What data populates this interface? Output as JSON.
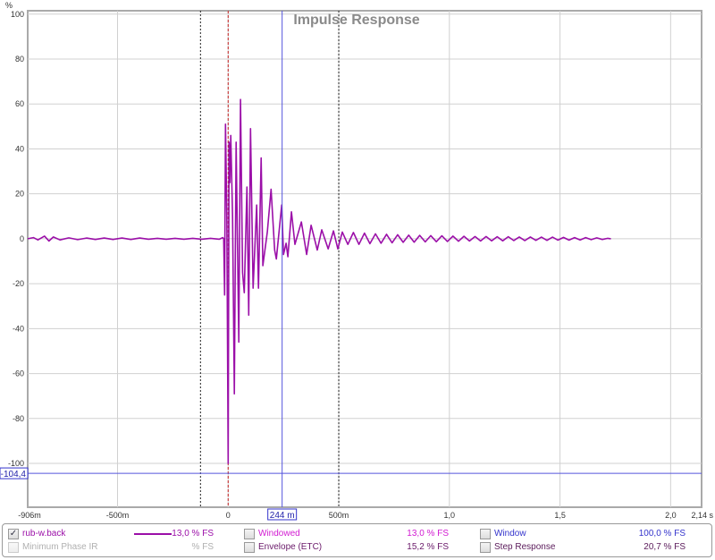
{
  "chart_data": {
    "type": "line",
    "title": "Impulse Response",
    "ylabel": "%",
    "xlabel_unit": "s",
    "xlim": [
      -0.906,
      2.14
    ],
    "ylim": [
      -119.5,
      101.5
    ],
    "grid": true,
    "y_ticks": [
      100,
      80,
      60,
      40,
      20,
      0,
      -20,
      -40,
      -60,
      -80,
      -100
    ],
    "y_tick_labels": [
      "100",
      "80",
      "60",
      "40",
      "20",
      "0",
      "-20",
      "-40",
      "-60",
      "-80",
      "-100"
    ],
    "x_ticks": [
      {
        "value": -0.906,
        "label": "-906m"
      },
      {
        "value": -0.5,
        "label": "-500m"
      },
      {
        "value": 0,
        "label": "0"
      },
      {
        "value": 0.5,
        "label": "500m"
      },
      {
        "value": 1.0,
        "label": "1,0"
      },
      {
        "value": 1.5,
        "label": "1,5"
      },
      {
        "value": 2.0,
        "label": "2,0"
      },
      {
        "value": 2.14,
        "label": "2,14 s"
      }
    ],
    "x_gridlines": [
      -0.5,
      0,
      0.5,
      1.0,
      1.5,
      2.0
    ],
    "window_markers": [
      -0.125,
      0.5
    ],
    "peak_marker": 0.0,
    "cursor": {
      "x": 0.244,
      "x_label": "244 m",
      "y": -104.4,
      "y_label": "-104,4"
    },
    "series": [
      {
        "name": "rub-w.back",
        "color": "#9b0fa8",
        "points": [
          [
            -0.906,
            0
          ],
          [
            -0.88,
            0.5
          ],
          [
            -0.86,
            -0.5
          ],
          [
            -0.83,
            1.2
          ],
          [
            -0.81,
            -1
          ],
          [
            -0.79,
            0.8
          ],
          [
            -0.76,
            -0.5
          ],
          [
            -0.72,
            0.4
          ],
          [
            -0.68,
            -0.4
          ],
          [
            -0.64,
            0.3
          ],
          [
            -0.6,
            -0.3
          ],
          [
            -0.56,
            0.3
          ],
          [
            -0.52,
            -0.3
          ],
          [
            -0.48,
            0.3
          ],
          [
            -0.44,
            -0.3
          ],
          [
            -0.4,
            0.3
          ],
          [
            -0.36,
            -0.2
          ],
          [
            -0.32,
            0.2
          ],
          [
            -0.28,
            -0.2
          ],
          [
            -0.24,
            0.2
          ],
          [
            -0.2,
            -0.2
          ],
          [
            -0.16,
            0.2
          ],
          [
            -0.12,
            -0.2
          ],
          [
            -0.08,
            0.2
          ],
          [
            -0.04,
            -0.2
          ],
          [
            -0.024,
            0.5
          ],
          [
            -0.02,
            0
          ],
          [
            -0.016,
            -25
          ],
          [
            -0.012,
            51
          ],
          [
            -0.006,
            10
          ],
          [
            0.0,
            -100
          ],
          [
            0.004,
            43
          ],
          [
            0.008,
            25
          ],
          [
            0.012,
            46
          ],
          [
            0.02,
            10
          ],
          [
            0.028,
            -69
          ],
          [
            0.036,
            43
          ],
          [
            0.048,
            -46
          ],
          [
            0.056,
            62
          ],
          [
            0.065,
            -15
          ],
          [
            0.073,
            -24
          ],
          [
            0.085,
            23
          ],
          [
            0.093,
            -34
          ],
          [
            0.101,
            49
          ],
          [
            0.113,
            -22
          ],
          [
            0.129,
            15
          ],
          [
            0.137,
            -22
          ],
          [
            0.149,
            36
          ],
          [
            0.157,
            -12
          ],
          [
            0.177,
            3
          ],
          [
            0.194,
            22
          ],
          [
            0.21,
            -5
          ],
          [
            0.218,
            -9
          ],
          [
            0.242,
            15
          ],
          [
            0.25,
            -7
          ],
          [
            0.262,
            -2
          ],
          [
            0.27,
            -8
          ],
          [
            0.286,
            12
          ],
          [
            0.302,
            -2.5
          ],
          [
            0.331,
            7.5
          ],
          [
            0.355,
            -7
          ],
          [
            0.375,
            6
          ],
          [
            0.403,
            -5
          ],
          [
            0.423,
            4
          ],
          [
            0.452,
            -4.5
          ],
          [
            0.476,
            3.5
          ],
          [
            0.496,
            -4.5
          ],
          [
            0.516,
            3
          ],
          [
            0.541,
            -2.5
          ],
          [
            0.566,
            2.8
          ],
          [
            0.591,
            -2.5
          ],
          [
            0.616,
            2.5
          ],
          [
            0.641,
            -2.2
          ],
          [
            0.666,
            2.2
          ],
          [
            0.691,
            -2
          ],
          [
            0.716,
            2
          ],
          [
            0.741,
            -1.8
          ],
          [
            0.766,
            1.8
          ],
          [
            0.791,
            -1.6
          ],
          [
            0.816,
            1.6
          ],
          [
            0.841,
            -1.5
          ],
          [
            0.866,
            1.5
          ],
          [
            0.891,
            -1.4
          ],
          [
            0.916,
            1.4
          ],
          [
            0.941,
            -1.3
          ],
          [
            0.966,
            1.3
          ],
          [
            0.991,
            -1.2
          ],
          [
            1.016,
            1.2
          ],
          [
            1.041,
            -1.1
          ],
          [
            1.066,
            1.1
          ],
          [
            1.091,
            -1
          ],
          [
            1.116,
            1
          ],
          [
            1.141,
            -1
          ],
          [
            1.166,
            1
          ],
          [
            1.191,
            -0.9
          ],
          [
            1.216,
            0.9
          ],
          [
            1.241,
            -0.9
          ],
          [
            1.266,
            0.9
          ],
          [
            1.291,
            -0.8
          ],
          [
            1.316,
            0.8
          ],
          [
            1.341,
            -0.8
          ],
          [
            1.366,
            0.8
          ],
          [
            1.391,
            -0.7
          ],
          [
            1.416,
            0.7
          ],
          [
            1.441,
            -0.7
          ],
          [
            1.466,
            0.7
          ],
          [
            1.491,
            -0.6
          ],
          [
            1.516,
            0.6
          ],
          [
            1.541,
            -0.6
          ],
          [
            1.566,
            0.5
          ],
          [
            1.591,
            -0.5
          ],
          [
            1.616,
            0.5
          ],
          [
            1.641,
            -0.4
          ],
          [
            1.666,
            0.4
          ],
          [
            1.691,
            -0.3
          ],
          [
            1.716,
            0.2
          ],
          [
            1.73,
            0
          ]
        ]
      }
    ]
  },
  "legend": {
    "row1": [
      {
        "label": "rub-w.back",
        "checked": true,
        "value": "13,0 % FS",
        "color": "#9b0fa8"
      },
      {
        "label": "Windowed",
        "checked": false,
        "value": "13,0 % FS",
        "color": "#d21bd2"
      },
      {
        "label": "Window",
        "checked": false,
        "value": "100,0 % FS",
        "color": "#3333cc"
      }
    ],
    "row2": [
      {
        "label": "Minimum Phase IR",
        "checked": false,
        "value": "% FS",
        "color": "#b0b0b0"
      },
      {
        "label": "Envelope (ETC)",
        "checked": false,
        "value": "15,2 % FS",
        "color": "#6a1a6a"
      },
      {
        "label": "Step Response",
        "checked": false,
        "value": "20,7 % FS",
        "color": "#5a1a5a"
      }
    ],
    "check_mark": "✓"
  }
}
